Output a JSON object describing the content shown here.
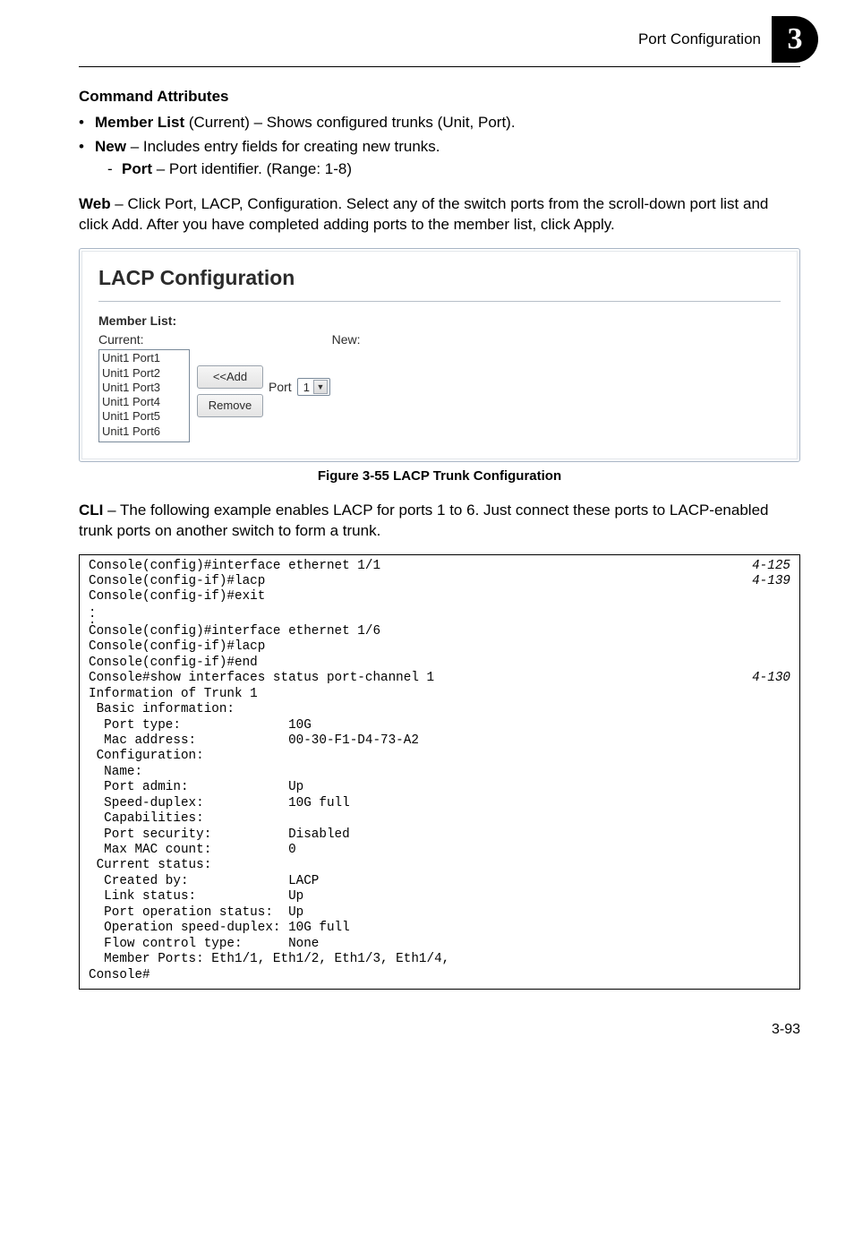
{
  "header": {
    "section_title": "Port Configuration",
    "badge_number": "3"
  },
  "cmd_attr": {
    "heading": "Command Attributes",
    "items": [
      {
        "label": "Member List",
        "paren": " (Current) –  ",
        "desc": "Shows configured trunks (Unit, Port)."
      },
      {
        "label": "New",
        "paren": " – ",
        "desc": "Includes entry fields for creating new trunks."
      }
    ],
    "sub": {
      "label": "Port",
      "paren": "  – ",
      "desc": "Port identifier. (Range: 1-8)"
    }
  },
  "web_para": {
    "label": "Web",
    "text": " – Click Port, LACP, Configuration. Select any of the switch ports from the scroll-down port list and click Add. After you have completed adding ports to the member list, click Apply."
  },
  "panel": {
    "title": "LACP Configuration",
    "member_list_label": "Member List:",
    "current_label": "Current:",
    "new_label": "New:",
    "list_items": [
      "Unit1 Port1",
      "Unit1 Port2",
      "Unit1 Port3",
      "Unit1 Port4",
      "Unit1 Port5",
      "Unit1 Port6"
    ],
    "add_btn": "<<Add",
    "remove_btn": "Remove",
    "port_label": "Port",
    "port_value": "1"
  },
  "figure_caption": "Figure 3-55   LACP Trunk Configuration",
  "cli_para": {
    "label": "CLI",
    "text": " – The following example enables LACP for ports 1 to 6. Just connect these ports to LACP-enabled trunk ports on another switch to form a trunk."
  },
  "cli": {
    "line1": "Console(config)#interface ethernet 1/1",
    "ref1": "4-125",
    "line2": "Console(config-if)#lacp",
    "ref2": "4-139",
    "block1": "Console(config-if)#exit",
    "block2": "Console(config)#interface ethernet 1/6\nConsole(config-if)#lacp\nConsole(config-if)#end",
    "line3": "Console#show interfaces status port-channel 1",
    "ref3": "4-130",
    "block3": "Information of Trunk 1\n Basic information:\n  Port type:              10G\n  Mac address:            00-30-F1-D4-73-A2\n Configuration:\n  Name:\n  Port admin:             Up\n  Speed-duplex:           10G full\n  Capabilities:\n  Port security:          Disabled\n  Max MAC count:          0\n Current status:\n  Created by:             LACP\n  Link status:            Up\n  Port operation status:  Up\n  Operation speed-duplex: 10G full\n  Flow control type:      None\n  Member Ports: Eth1/1, Eth1/2, Eth1/3, Eth1/4,\nConsole#"
  },
  "page_number": "3-93"
}
